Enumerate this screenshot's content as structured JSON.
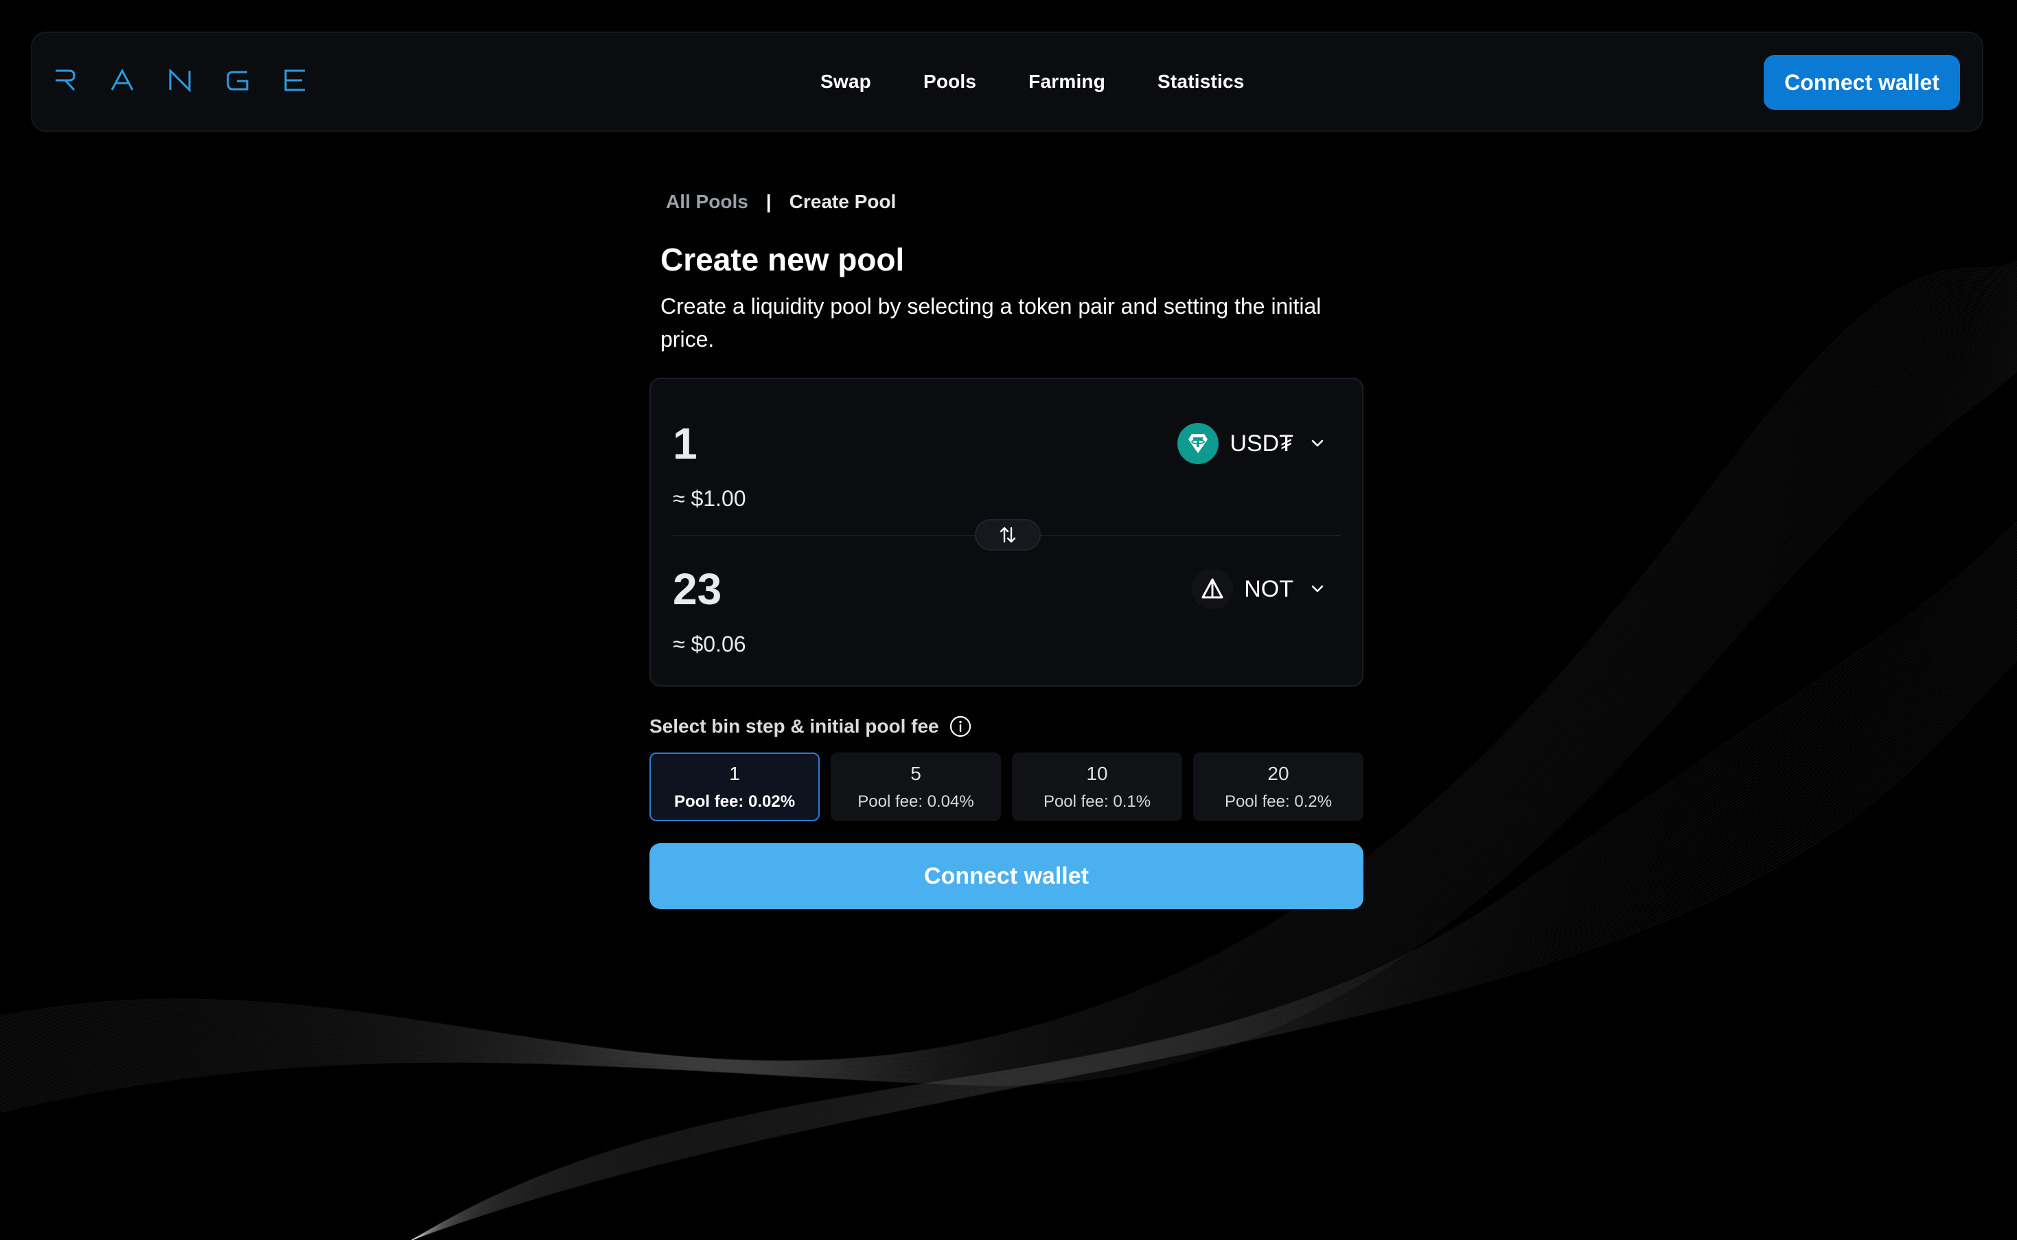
{
  "app": {
    "logo_letters": [
      "R",
      "A",
      "N",
      "G",
      "E"
    ],
    "accent_color": "#0a7ad4",
    "logo_color": "#2a9be0"
  },
  "header": {
    "nav": [
      {
        "label": "Swap"
      },
      {
        "label": "Pools"
      },
      {
        "label": "Farming"
      },
      {
        "label": "Statistics"
      }
    ],
    "connect_label": "Connect wallet"
  },
  "breadcrumb": {
    "parent": "All Pools",
    "separator": "|",
    "current": "Create Pool"
  },
  "page": {
    "title": "Create new pool",
    "description": "Create a liquidity pool by selecting a token pair and setting the initial price."
  },
  "swap": {
    "top": {
      "amount": "1",
      "usd_value": "≈ $1.00",
      "token_symbol": "USD₮",
      "token_icon": "tether-icon"
    },
    "bottom": {
      "amount": "23",
      "usd_value": "≈ $0.06",
      "token_symbol": "NOT",
      "token_icon": "notcoin-icon"
    },
    "toggle_icon": "swap-arrows-icon"
  },
  "fees": {
    "label": "Select bin step & initial pool fee",
    "options": [
      {
        "step": "1",
        "fee": "Pool fee: 0.02%",
        "selected": true
      },
      {
        "step": "5",
        "fee": "Pool fee: 0.04%",
        "selected": false
      },
      {
        "step": "10",
        "fee": "Pool fee: 0.1%",
        "selected": false
      },
      {
        "step": "20",
        "fee": "Pool fee: 0.2%",
        "selected": false
      }
    ]
  },
  "main_action": {
    "label": "Connect wallet",
    "color": "#4bb0f0"
  }
}
